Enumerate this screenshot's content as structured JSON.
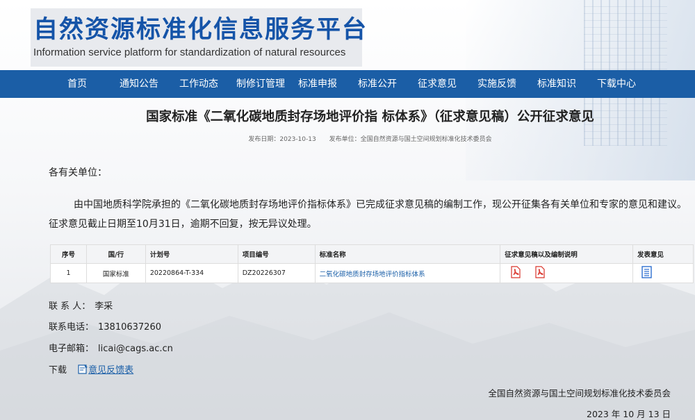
{
  "site": {
    "title_cn": "自然资源标准化信息服务平台",
    "title_en": "Information service platform for standardization of natural resources"
  },
  "nav": [
    {
      "label": "首页"
    },
    {
      "label": "通知公告"
    },
    {
      "label": "工作动态"
    },
    {
      "label": "制修订管理"
    },
    {
      "label": "标准申报"
    },
    {
      "label": "标准公开"
    },
    {
      "label": "征求意见"
    },
    {
      "label": "实施反馈"
    },
    {
      "label": "标准知识"
    },
    {
      "label": "下载中心"
    }
  ],
  "article": {
    "title": "国家标准《二氧化碳地质封存场地评价指 标体系》（征求意见稿）公开征求意见",
    "publish_date": "发布日期：2023-10-13",
    "publisher": "发布单位：全国自然资源与国土空间规划标准化技术委员会",
    "greeting": "各有关单位：",
    "body": "由中国地质科学院承担的《二氧化碳地质封存场地评价指标体系》已完成征求意见稿的编制工作，现公开征集各有关单位和专家的意见和建议。征求意见截止日期至10月31日，逾期不回复，按无异议处理。"
  },
  "table": {
    "headers": [
      "序号",
      "国/行",
      "计划号",
      "项目编号",
      "标准名称",
      "征求意见稿以及编制说明",
      "发表意见"
    ],
    "rows": [
      {
        "no": "1",
        "type": "国家标准",
        "plan": "20220864-T-334",
        "project": "DZ20226307",
        "name": "二氧化碳地质封存场地评价指标体系"
      }
    ]
  },
  "contact": {
    "person_label": "联 系 人：",
    "person": "李采",
    "phone_label": "联系电话：",
    "phone": "13810637260",
    "email_label": "电子邮箱：",
    "email": "licai@cags.ac.cn",
    "download_label": "下载",
    "download_link": "意见反馈表"
  },
  "footer": {
    "org": "全国自然资源与国土空间规划标准化技术委员会",
    "date": "2023 年 10 月 13 日"
  },
  "colors": {
    "brand": "#1554a8",
    "nav_bg": "#1b5ea6",
    "link": "#1a5fa8",
    "pdf_red": "#d9342b",
    "doc_blue": "#2e6fd0"
  }
}
